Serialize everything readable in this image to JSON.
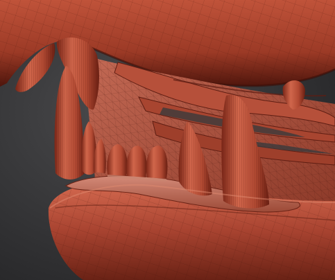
{
  "viewport": {
    "subject": "creature-jaw-sculpt",
    "colors": {
      "background_top": "#4a4a4c",
      "background_bottom": "#1f1f21",
      "clay_light": "#d96a4f",
      "clay_mid": "#a83f2b",
      "clay_dark": "#5e1d12",
      "wire": "#2a0a05",
      "gum_pink": "#c47b6a"
    },
    "teeth": [
      {
        "name": "upper-incisor-small"
      },
      {
        "name": "upper-incisor-large"
      },
      {
        "name": "lower-canine-left"
      },
      {
        "name": "lower-molar-row"
      },
      {
        "name": "lower-fang-mid"
      },
      {
        "name": "lower-canine-right"
      }
    ]
  }
}
